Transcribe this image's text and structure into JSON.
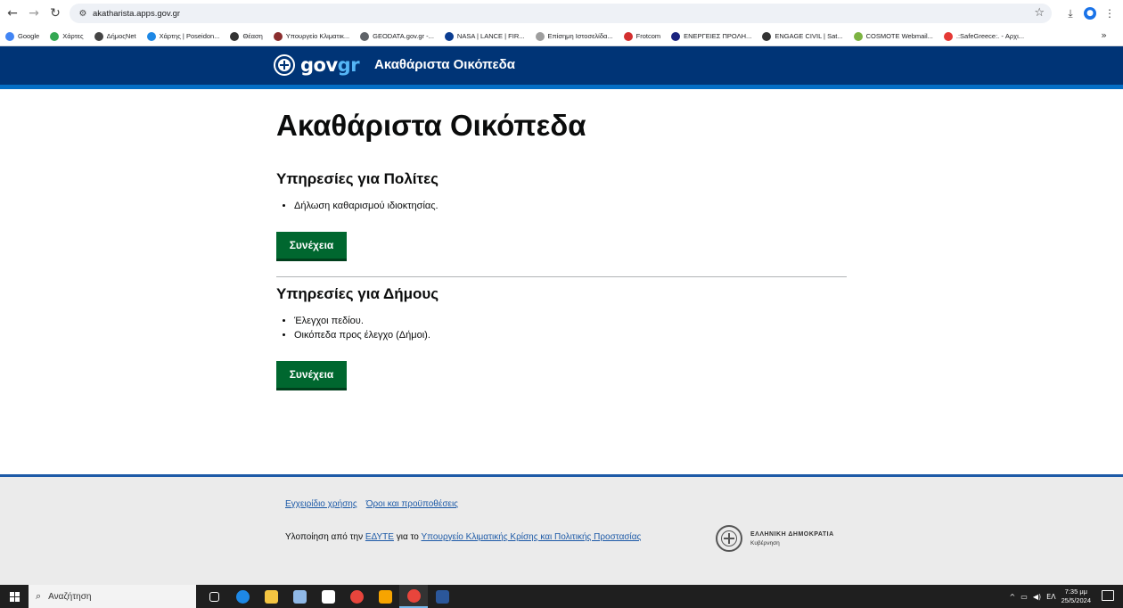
{
  "browser": {
    "url": "akatharista.apps.gov.gr",
    "bookmarks": [
      {
        "label": "Google",
        "color": "#4285f4"
      },
      {
        "label": "Χάρτες",
        "color": "#34a853"
      },
      {
        "label": "ΔήμοςNet",
        "color": "#444444"
      },
      {
        "label": "Χάρτης | Poseidon...",
        "color": "#1e88e5"
      },
      {
        "label": "Θέαση",
        "color": "#333333"
      },
      {
        "label": "Υπουργείο Κλιματικ...",
        "color": "#8b2e2e"
      },
      {
        "label": "GEODATA.gov.gr -...",
        "color": "#5f6368"
      },
      {
        "label": "NASA | LANCE | FIR...",
        "color": "#0b3d91"
      },
      {
        "label": "Επίσημη Ιστοσελίδα...",
        "color": "#9e9e9e"
      },
      {
        "label": "Frotcom",
        "color": "#d32f2f"
      },
      {
        "label": "ΕΝΕΡΓΕΙΕΣ ΠΡΟΛΗ...",
        "color": "#1a237e"
      },
      {
        "label": "ENGAGE CIVIL | Sat...",
        "color": "#333333"
      },
      {
        "label": "COSMOTE Webmail...",
        "color": "#7cb342"
      },
      {
        "label": ".:SafeGreece:. - Αρχι...",
        "color": "#e53935"
      }
    ],
    "more": "»"
  },
  "header": {
    "logo_gov": "gov",
    "logo_gr": "gr",
    "title": "Ακαθάριστα Οικόπεδα"
  },
  "main": {
    "title": "Ακαθάριστα Οικόπεδα",
    "citizens": {
      "heading": "Υπηρεσίες για Πολίτες",
      "items": [
        "Δήλωση καθαρισμού ιδιοκτησίας."
      ],
      "button": "Συνέχεια"
    },
    "municipalities": {
      "heading": "Υπηρεσίες για Δήμους",
      "items": [
        "Έλεγχοι πεδίου.",
        "Οικόπεδα προς έλεγχο (Δήμοι)."
      ],
      "button": "Συνέχεια"
    }
  },
  "footer": {
    "links": [
      "Εγχειρίδιο χρήσης",
      "Όροι και προϋποθέσεις"
    ],
    "impl_prefix": "Υλοποίηση από την",
    "impl_org": "ΕΔΥΤΕ",
    "impl_mid": "για το",
    "impl_ministry": "Υπουργείο Κλιματικής Κρίσης και Πολιτικής Προστασίας",
    "gov_name": "ΕΛΛΗΝΙΚΗ ΔΗΜΟΚΡΑΤΙΑ",
    "gov_sub": "Κυβέρνηση"
  },
  "taskbar": {
    "search_placeholder": "Αναζήτηση",
    "apps": [
      {
        "name": "task-view",
        "color": "#1f1f1f"
      },
      {
        "name": "edge",
        "color": "#1e88e5"
      },
      {
        "name": "file-explorer",
        "color": "#f4c542"
      },
      {
        "name": "notepad",
        "color": "#8fb8e6"
      },
      {
        "name": "blank-document",
        "color": "#ffffff"
      },
      {
        "name": "chrome",
        "color": "#e8453c"
      },
      {
        "name": "outlook",
        "color": "#f7a400"
      },
      {
        "name": "chrome-active",
        "color": "#e8453c"
      },
      {
        "name": "word",
        "color": "#2b579a"
      }
    ],
    "lang": "ΕΛ",
    "time": "7:35 μμ",
    "date": "25/5/2024"
  }
}
